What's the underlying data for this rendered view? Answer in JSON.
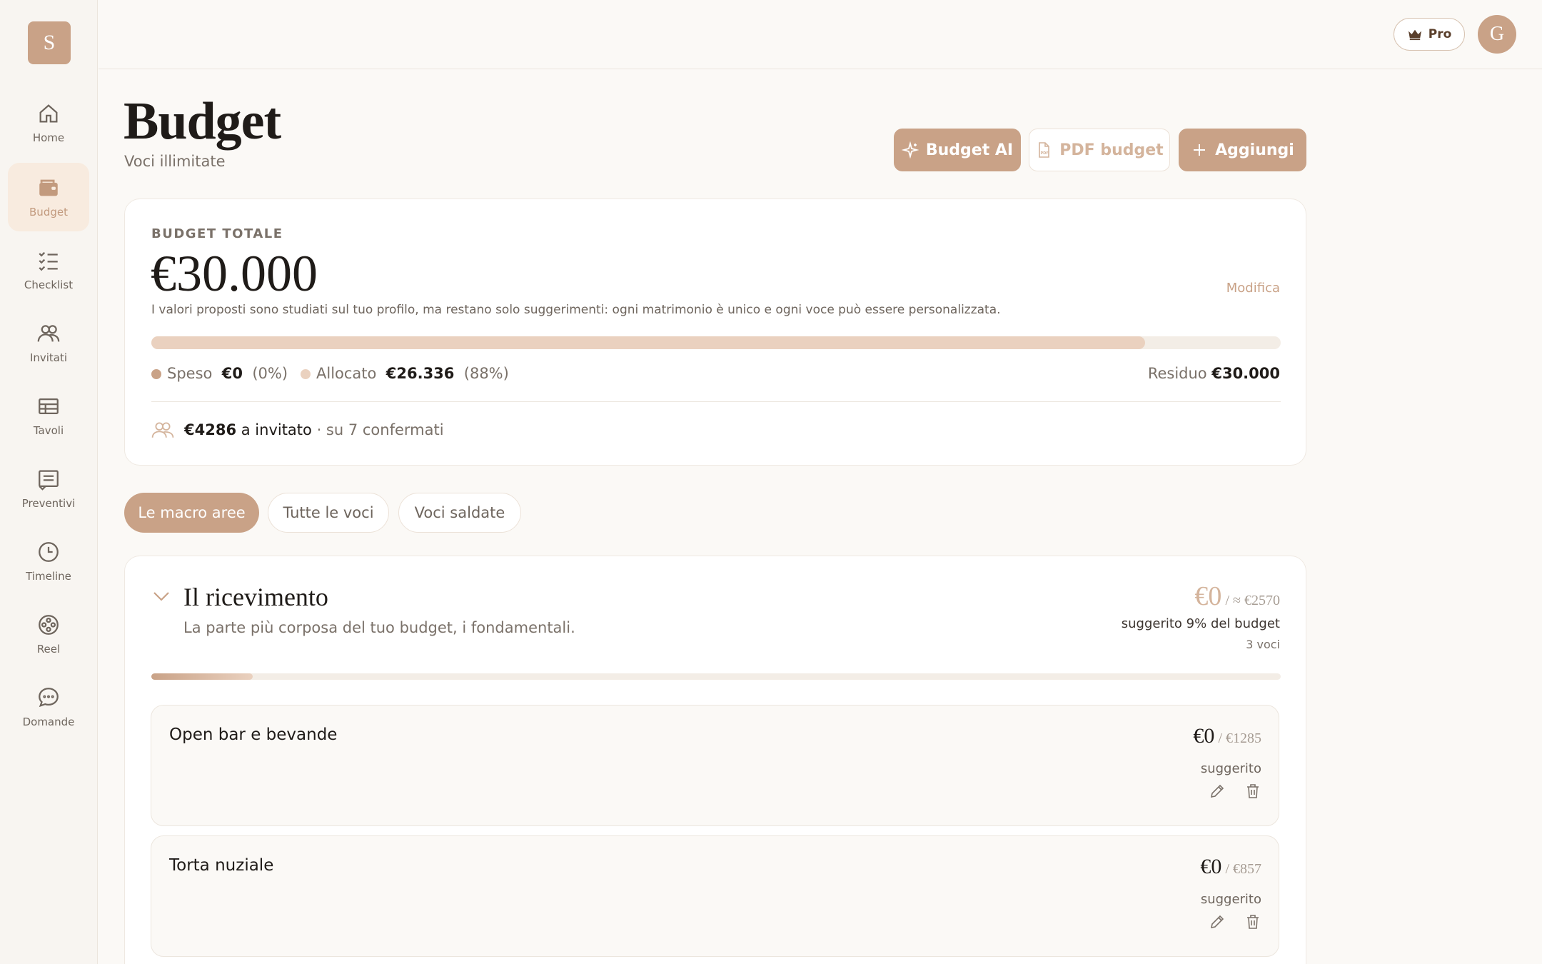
{
  "app": {
    "logo_letter": "S",
    "user_initial": "G",
    "pro_label": "Pro"
  },
  "nav": [
    {
      "label": "Home",
      "icon": "home-icon"
    },
    {
      "label": "Budget",
      "icon": "wallet-icon"
    },
    {
      "label": "Checklist",
      "icon": "checklist-icon"
    },
    {
      "label": "Invitati",
      "icon": "guests-icon"
    },
    {
      "label": "Tavoli",
      "icon": "tables-icon"
    },
    {
      "label": "Preventivi",
      "icon": "quotes-icon"
    },
    {
      "label": "Timeline",
      "icon": "clock-icon"
    },
    {
      "label": "Reel",
      "icon": "reel-icon"
    },
    {
      "label": "Domande",
      "icon": "chat-icon"
    }
  ],
  "header": {
    "title": "Budget",
    "subtitle": "Voci illimitate",
    "btn_ai": "Budget AI",
    "btn_pdf": "PDF budget",
    "btn_add": "Aggiungi"
  },
  "summary": {
    "label": "BUDGET TOTALE",
    "amount": "€30.000",
    "edit": "Modifica",
    "note": "I valori proposti sono studiati sul tuo profilo, ma restano solo suggerimenti: ogni matrimonio è unico e ogni voce può essere personalizzata.",
    "allocated_fraction": 0.88,
    "spent_label": "Speso",
    "spent_value": "€0",
    "spent_pct": "(0%)",
    "alloc_label": "Allocato",
    "alloc_value": "€26.336",
    "alloc_pct": "(88%)",
    "residual_label": "Residuo",
    "residual_value": "€30.000",
    "per_guest_value": "€4286",
    "per_guest_label": "a invitato",
    "per_guest_suffix": "· su 7 confermati"
  },
  "tabs": [
    {
      "label": "Le macro aree",
      "active": true
    },
    {
      "label": "Tutte le voci",
      "active": false
    },
    {
      "label": "Voci saldate",
      "active": false
    }
  ],
  "section": {
    "title": "Il ricevimento",
    "description": "La parte più corposa del tuo budget, i fondamentali.",
    "spent": "€0",
    "estimate": "/ ≈ €2570",
    "suggested": "suggerito 9% del budget",
    "count": "3 voci",
    "progress_fraction": 0.09,
    "items": [
      {
        "name": "Open bar e bevande",
        "amount": "€0",
        "suggested": "/ €1285",
        "suggested_label": "suggerito"
      },
      {
        "name": "Torta nuziale",
        "amount": "€0",
        "suggested": "/ €857",
        "suggested_label": "suggerito"
      }
    ]
  },
  "colors": {
    "accent": "#c9a287",
    "accent_light": "#ead1bf",
    "background": "#fbf9f6"
  }
}
